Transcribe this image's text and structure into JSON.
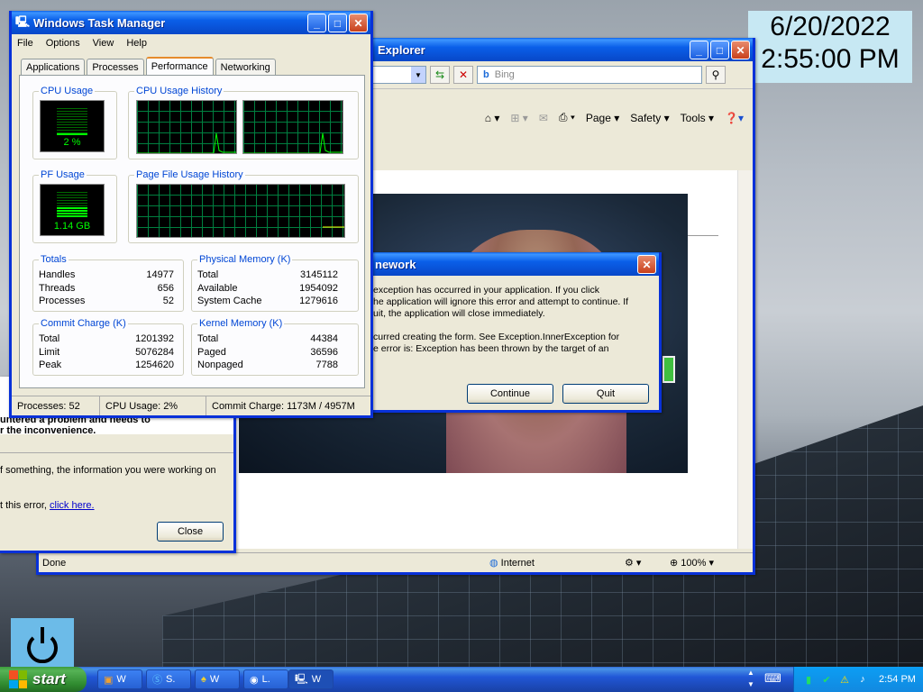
{
  "clock": {
    "date": "6/20/2022",
    "time": "2:55:00 PM"
  },
  "ie": {
    "title": "Explorer",
    "search_placeholder": "Bing",
    "commands": {
      "page": "Page",
      "safety": "Safety",
      "tools": "Tools"
    },
    "status": {
      "text": "Done",
      "zone": "Internet",
      "zoom": "100%"
    }
  },
  "error_report": {
    "heading_line1": "untered a problem and needs to",
    "heading_line2": "r the inconvenience.",
    "body_line1": "f something, the information you were working on",
    "body_prefix": "t this error,",
    "link": "click here.",
    "close_label": "Close"
  },
  "framework_dialog": {
    "title": "nework",
    "line1": "exception has occurred in your application. If you click",
    "line2": "he application will ignore this error and attempt to continue. If",
    "line3": "uit, the application will close immediately.",
    "line4": "curred creating the form. See Exception.InnerException for",
    "line5": "e error is: Exception has been thrown by the target of an",
    "continue_label": "Continue",
    "quit_label": "Quit"
  },
  "task_manager": {
    "title": "Windows Task Manager",
    "menu": [
      "File",
      "Options",
      "View",
      "Help"
    ],
    "tabs": [
      "Applications",
      "Processes",
      "Performance",
      "Networking"
    ],
    "cpu_usage_label": "CPU Usage",
    "cpu_usage_value": "2 %",
    "cpu_history_label": "CPU Usage History",
    "pf_usage_label": "PF Usage",
    "pf_usage_value": "1.14 GB",
    "pf_history_label": "Page File Usage History",
    "totals": {
      "label": "Totals",
      "rows": [
        [
          "Handles",
          "14977"
        ],
        [
          "Threads",
          "656"
        ],
        [
          "Processes",
          "52"
        ]
      ]
    },
    "physical": {
      "label": "Physical Memory (K)",
      "rows": [
        [
          "Total",
          "3145112"
        ],
        [
          "Available",
          "1954092"
        ],
        [
          "System Cache",
          "1279616"
        ]
      ]
    },
    "commit": {
      "label": "Commit Charge (K)",
      "rows": [
        [
          "Total",
          "1201392"
        ],
        [
          "Limit",
          "5076284"
        ],
        [
          "Peak",
          "1254620"
        ]
      ]
    },
    "kernel": {
      "label": "Kernel Memory (K)",
      "rows": [
        [
          "Total",
          "44384"
        ],
        [
          "Paged",
          "36596"
        ],
        [
          "Nonpaged",
          "7788"
        ]
      ]
    },
    "status": {
      "processes": "Processes: 52",
      "cpu": "CPU Usage: 2%",
      "commit": "Commit Charge: 1173M / 4957M"
    }
  },
  "taskbar": {
    "start_label": "start",
    "items": [
      "W",
      "S.",
      "W",
      "L.",
      "W"
    ],
    "tray_time": "2:54 PM"
  }
}
